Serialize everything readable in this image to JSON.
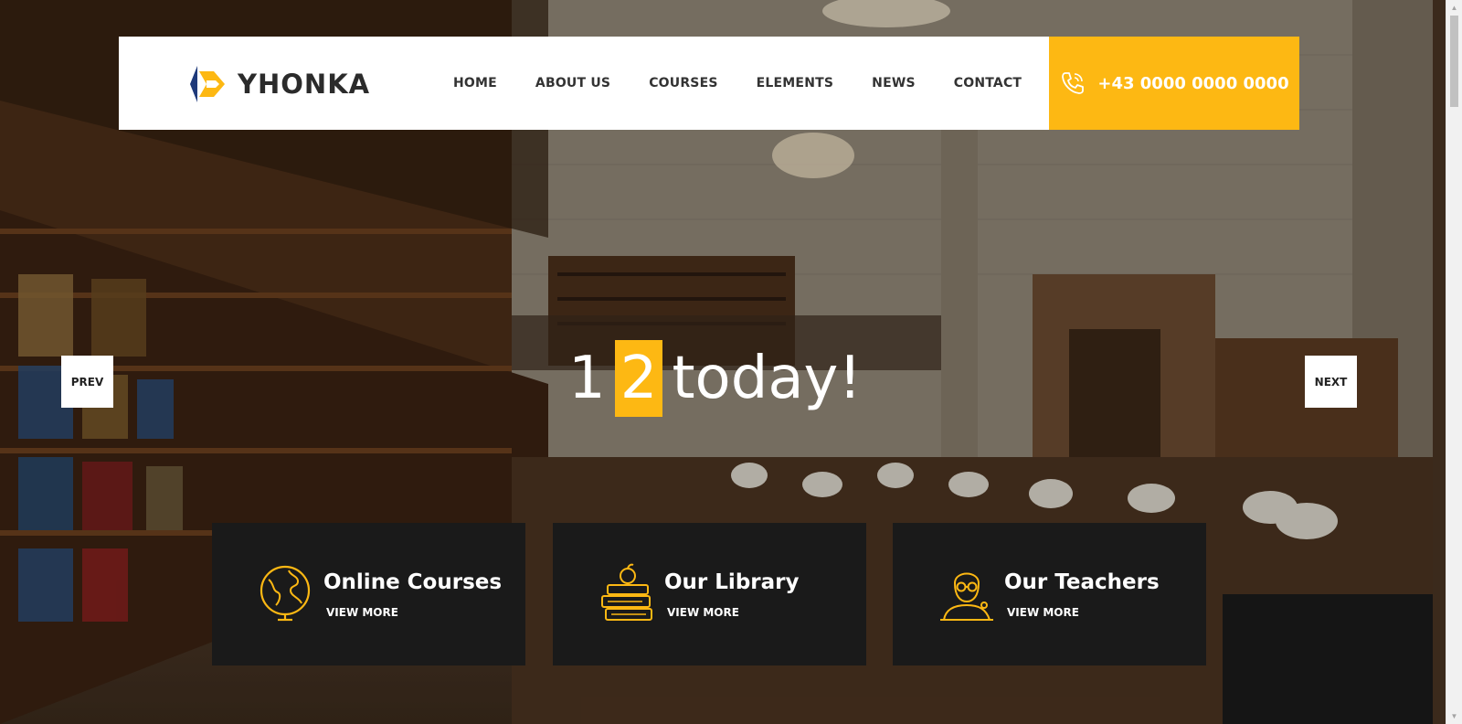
{
  "brand": {
    "name": "YHONKA"
  },
  "nav": {
    "items": [
      {
        "label": "HOME"
      },
      {
        "label": "ABOUT US"
      },
      {
        "label": "COURSES"
      },
      {
        "label": "ELEMENTS"
      },
      {
        "label": "NEWS"
      },
      {
        "label": "CONTACT"
      }
    ]
  },
  "contact": {
    "phone": "+43 0000 0000 0000",
    "icon": "phone-icon"
  },
  "slider": {
    "prev_label": "PREV",
    "next_label": "NEXT",
    "headline_part1": "1",
    "headline_highlight": "2",
    "headline_part2": "today!"
  },
  "cards": [
    {
      "title": "Online Courses",
      "link": "VIEW MORE",
      "icon": "globe-icon"
    },
    {
      "title": "Our Library",
      "link": "VIEW MORE",
      "icon": "books-icon"
    },
    {
      "title": "Our Teachers",
      "link": "VIEW MORE",
      "icon": "teacher-icon"
    }
  ],
  "colors": {
    "accent": "#fdb813",
    "card_bg": "#1a1a1a",
    "header_bg": "#ffffff",
    "logo_blue": "#1f3a7a"
  }
}
